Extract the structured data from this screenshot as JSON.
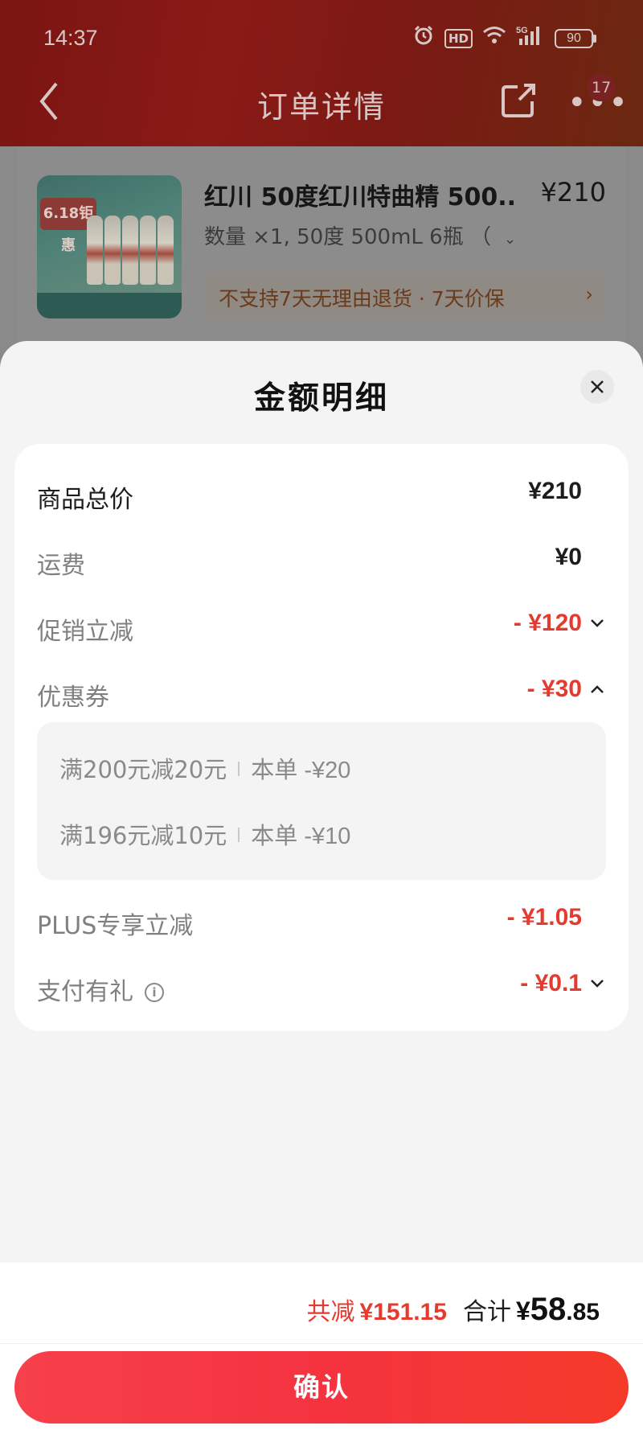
{
  "status_bar": {
    "time": "14:37",
    "icons": [
      "alarm-icon",
      "hd-icon",
      "wifi-icon",
      "signal-5g-icon",
      "battery-icon"
    ],
    "hd_label": "HD",
    "network_label": "5G",
    "battery_level": "90"
  },
  "nav": {
    "title": "订单详情",
    "more_badge": "17"
  },
  "product": {
    "title": "红川 50度红川特曲精 500...",
    "price": "¥210",
    "spec": "数量 ×1, 50度 500mL 6瓶 （",
    "spec_chevron": "⌄",
    "thumb_banner": "6.18钜惠",
    "policy": "不支持7天无理由退货 · 7天价保",
    "policy_arrow": "›"
  },
  "sheet": {
    "title": "金额明细",
    "rows": [
      {
        "label": "商品总价",
        "value": "¥210"
      },
      {
        "label": "运费",
        "value": "¥0"
      },
      {
        "label": "促销立减",
        "value": "- ¥120",
        "chevron": "down"
      },
      {
        "label": "优惠券",
        "value": "- ¥30",
        "chevron": "up"
      },
      {
        "label": "PLUS专享立减",
        "value": "- ¥1.05"
      },
      {
        "label": "支付有礼",
        "value": "- ¥0.1",
        "chevron": "down",
        "info_icon": "i"
      }
    ],
    "coupons": [
      {
        "rule": "满200元减20元",
        "amount": "本单 -¥20"
      },
      {
        "rule": "满196元减10元",
        "amount": "本单 -¥10"
      }
    ]
  },
  "footer": {
    "saved_label": "共减",
    "saved_value": "¥151.15",
    "total_label": "合计",
    "total_currency": "¥",
    "total_int": "58",
    "total_dec": ".85",
    "confirm_label": "确认"
  },
  "colors": {
    "accent_red": "#e43b30",
    "button_red": "#f4333f"
  }
}
